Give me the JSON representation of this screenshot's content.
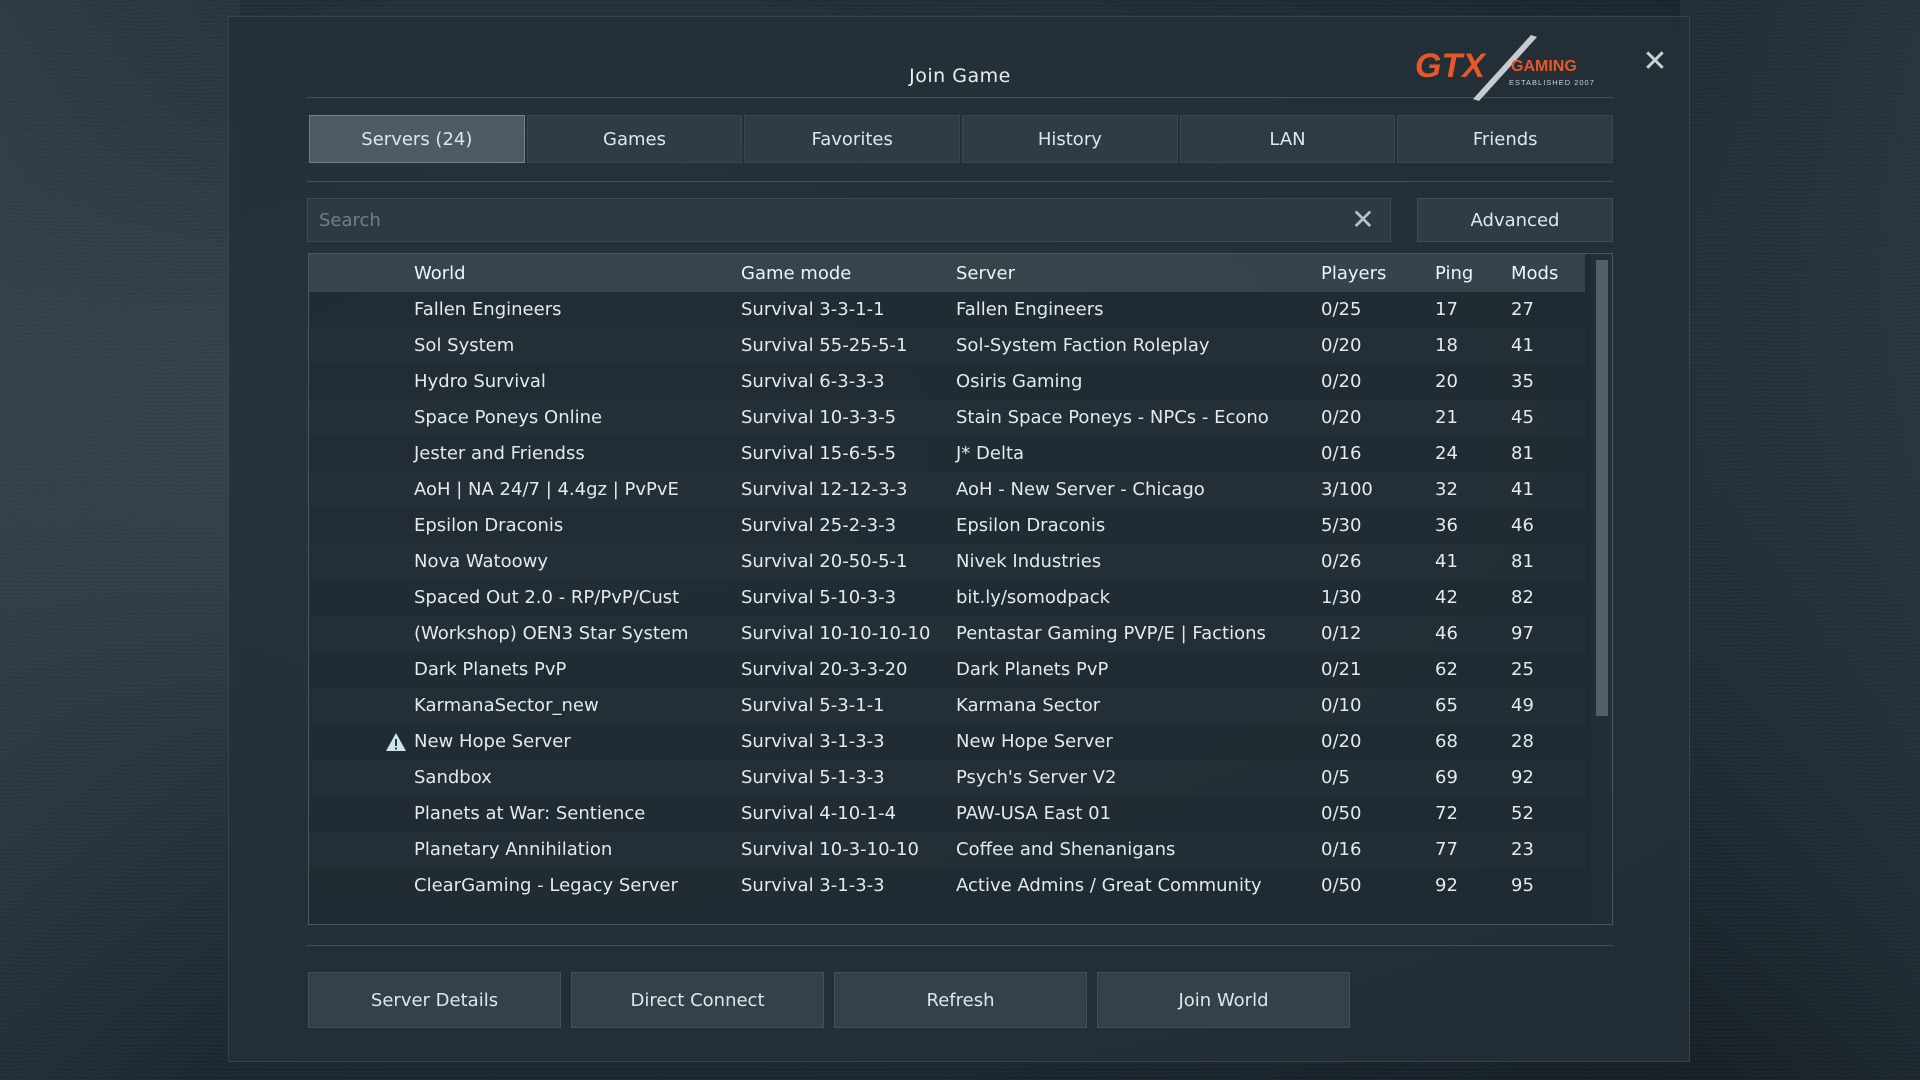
{
  "dialog": {
    "title": "Join Game",
    "close_icon": "close-icon",
    "logo": {
      "text_main": "GTX",
      "text_sub": "GAMING",
      "text_est": "ESTABLISHED 2007",
      "accent": "#e8562a"
    }
  },
  "tabs": [
    {
      "label": "Servers (24)",
      "active": true
    },
    {
      "label": "Games"
    },
    {
      "label": "Favorites"
    },
    {
      "label": "History"
    },
    {
      "label": "LAN"
    },
    {
      "label": "Friends"
    }
  ],
  "search": {
    "placeholder": "Search",
    "value": "",
    "clear_icon": "close-icon"
  },
  "advanced_label": "Advanced",
  "table": {
    "headers": {
      "world": "World",
      "mode": "Game mode",
      "server": "Server",
      "players": "Players",
      "ping": "Ping",
      "mods": "Mods"
    },
    "rows": [
      {
        "world": "Fallen Engineers",
        "mode": "Survival 3-3-1-1",
        "server": "Fallen Engineers",
        "players": "0/25",
        "ping": "17",
        "mods": "27"
      },
      {
        "world": "Sol System",
        "mode": "Survival 55-25-5-1",
        "server": "Sol-System Faction Roleplay",
        "players": "0/20",
        "ping": "18",
        "mods": "41"
      },
      {
        "world": "Hydro Survival",
        "mode": "Survival 6-3-3-3",
        "server": "Osiris Gaming",
        "players": "0/20",
        "ping": "20",
        "mods": "35"
      },
      {
        "world": "Space Poneys Online",
        "mode": "Survival 10-3-3-5",
        "server": "Stain Space Poneys - NPCs - Econo",
        "players": "0/20",
        "ping": "21",
        "mods": "45"
      },
      {
        "world": "Jester and Friendss",
        "mode": "Survival 15-6-5-5",
        "server": "J* Delta",
        "players": "0/16",
        "ping": "24",
        "mods": "81"
      },
      {
        "world": "AoH | NA 24/7 | 4.4gz | PvPvE",
        "mode": "Survival 12-12-3-3",
        "server": "AoH - New Server - Chicago",
        "players": "3/100",
        "ping": "32",
        "mods": "41"
      },
      {
        "world": "Epsilon Draconis",
        "mode": "Survival 25-2-3-3",
        "server": "Epsilon Draconis",
        "players": "5/30",
        "ping": "36",
        "mods": "46"
      },
      {
        "world": "Nova Watoowy",
        "mode": "Survival 20-50-5-1",
        "server": "Nivek Industries",
        "players": "0/26",
        "ping": "41",
        "mods": "81"
      },
      {
        "world": "Spaced Out 2.0 - RP/PvP/Cust",
        "mode": "Survival 5-10-3-3",
        "server": "bit.ly/somodpack",
        "players": "1/30",
        "ping": "42",
        "mods": "82"
      },
      {
        "world": "(Workshop) OEN3 Star System",
        "mode": "Survival 10-10-10-10",
        "server": "Pentastar Gaming PVP/E | Factions",
        "players": "0/12",
        "ping": "46",
        "mods": "97"
      },
      {
        "world": "Dark Planets PvP",
        "mode": "Survival 20-3-3-20",
        "server": "Dark Planets PvP",
        "players": "0/21",
        "ping": "62",
        "mods": "25"
      },
      {
        "world": "KarmanaSector_new",
        "mode": "Survival 5-3-1-1",
        "server": "Karmana Sector",
        "players": "0/10",
        "ping": "65",
        "mods": "49"
      },
      {
        "world": "New Hope Server",
        "mode": "Survival 3-1-3-3",
        "server": "New Hope Server",
        "players": "0/20",
        "ping": "68",
        "mods": "28",
        "warning": true
      },
      {
        "world": "Sandbox",
        "mode": "Survival 5-1-3-3",
        "server": "Psych's Server V2",
        "players": "0/5",
        "ping": "69",
        "mods": "92"
      },
      {
        "world": "Planets at War: Sentience",
        "mode": "Survival 4-10-1-4",
        "server": "PAW-USA East 01",
        "players": "0/50",
        "ping": "72",
        "mods": "52"
      },
      {
        "world": "Planetary Annihilation",
        "mode": "Survival 10-3-10-10",
        "server": "Coffee and Shenanigans",
        "players": "0/16",
        "ping": "77",
        "mods": "23"
      },
      {
        "world": "ClearGaming - Legacy Server",
        "mode": "Survival 3-1-3-3",
        "server": "Active Admins / Great Community",
        "players": "0/50",
        "ping": "92",
        "mods": "95"
      }
    ]
  },
  "buttons": {
    "server_details": "Server Details",
    "direct_connect": "Direct Connect",
    "refresh": "Refresh",
    "join_world": "Join World"
  },
  "colors": {
    "panel": "#243038",
    "accent_logo": "#e8562a",
    "warning": "#cfe3f0"
  }
}
